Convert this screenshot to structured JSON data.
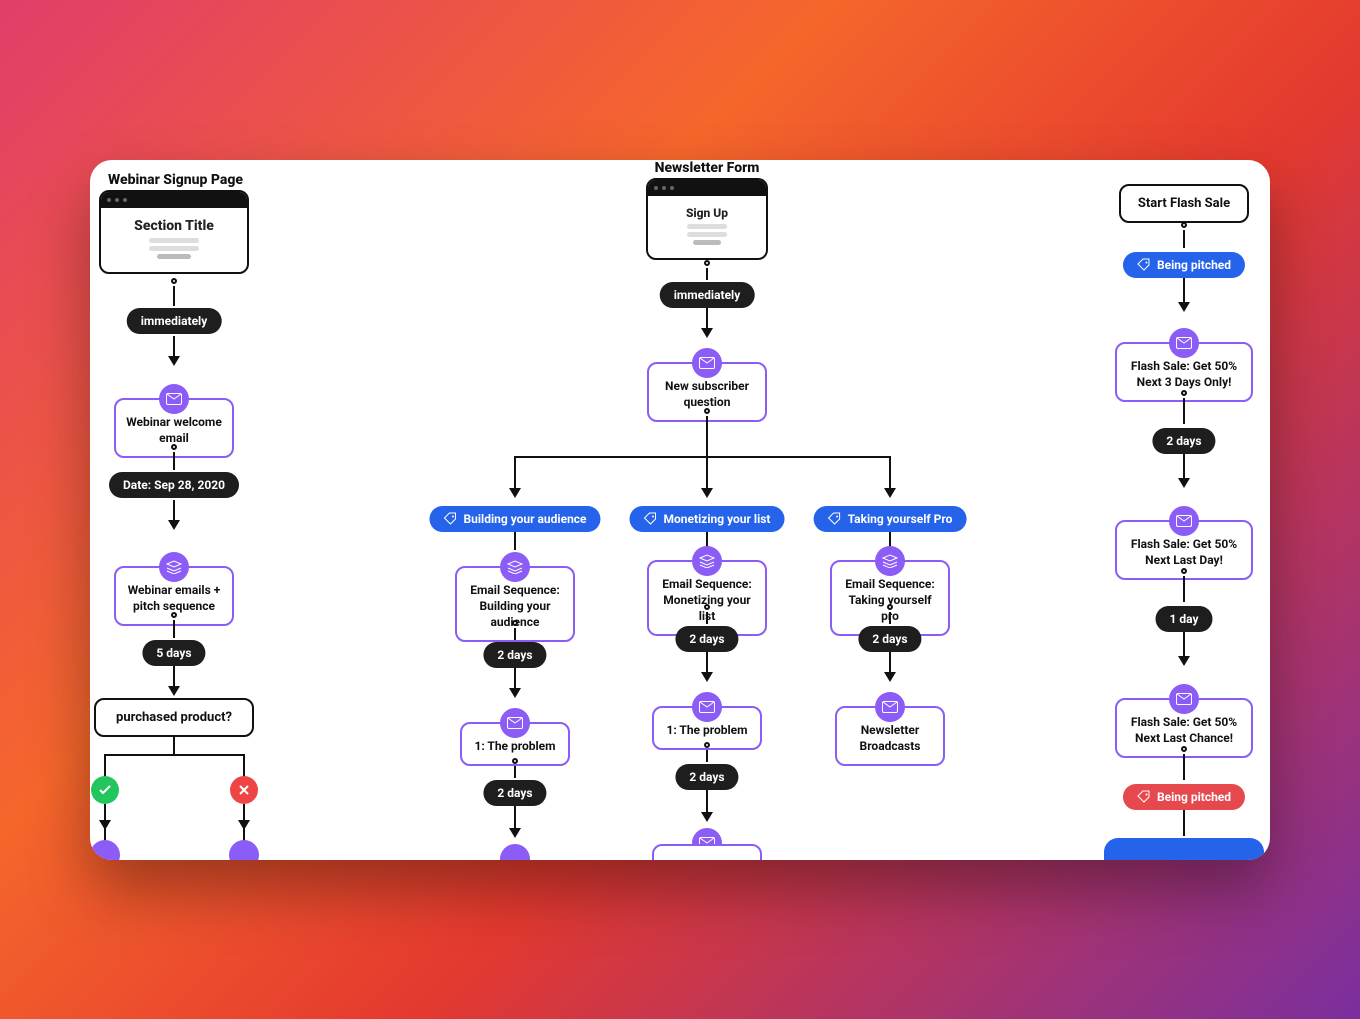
{
  "labels": {
    "webinar_title": "Webinar Signup Page",
    "newsletter_title": "Newsletter Form",
    "section_title": "Section Title",
    "signup_title": "Sign Up"
  },
  "colA": {
    "delay1": "immediately",
    "email1": "Webinar welcome email",
    "date": "Date: Sep 28, 2020",
    "seq1": "Webinar emails + pitch sequence",
    "delay2": "5 days",
    "cond": "purchased product?"
  },
  "colC_top": {
    "delay1": "immediately",
    "email1": "New subscriber question"
  },
  "branchB": {
    "tag": "Building your audience",
    "seq": "Email Sequence: Building your audience",
    "delay1": "2 days",
    "email1": "1: The problem",
    "delay2": "2 days"
  },
  "branchC": {
    "tag": "Monetizing your list",
    "seq": "Email Sequence: Monetizing your list",
    "delay1": "2 days",
    "email1": "1: The problem",
    "delay2": "2 days"
  },
  "branchD": {
    "tag": "Taking yourself Pro",
    "seq": "Email Sequence: Taking yourself pro",
    "delay1": "2 days",
    "email1": "Newsletter Broadcasts"
  },
  "colE": {
    "start": "Start Flash Sale",
    "tag1": "Being pitched",
    "email1": "Flash Sale: Get 50% Next 3 Days Only!",
    "delay1": "2 days",
    "email2": "Flash Sale: Get 50% Next Last Day!",
    "delay2": "1 day",
    "email3": "Flash Sale: Get 50% Next Last Chance!",
    "tag2": "Being pitched"
  }
}
